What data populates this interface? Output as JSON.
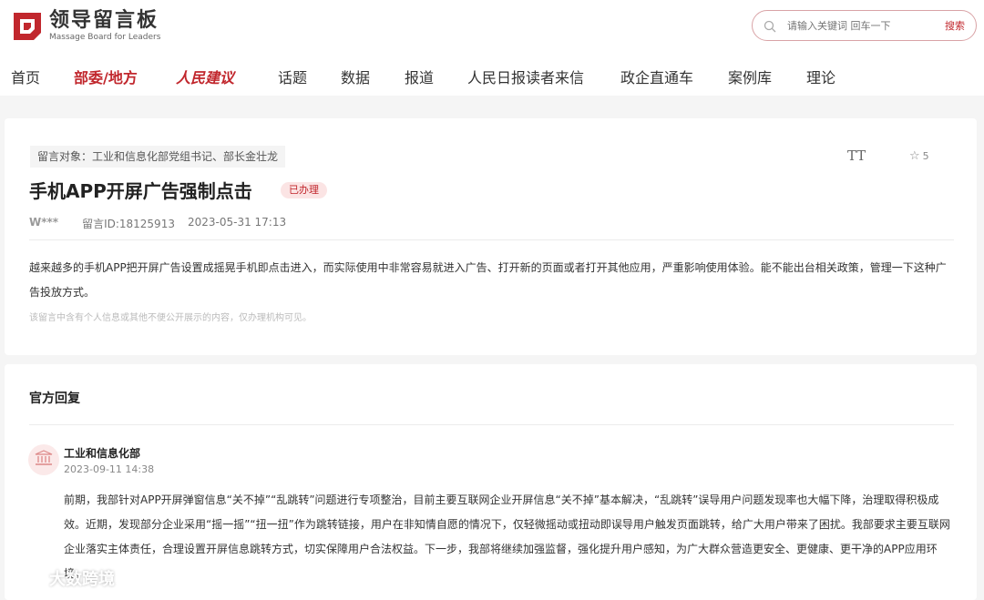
{
  "header": {
    "logo_title": "领导留言板",
    "logo_subtitle": "Massage Board for Leaders",
    "search": {
      "placeholder": "请输入关键词 回车一下",
      "button_label": "搜索"
    }
  },
  "nav": [
    {
      "label": "首页",
      "active": false
    },
    {
      "label": "部委/地方",
      "active": true
    },
    {
      "label": "人民建议",
      "active": false
    },
    {
      "label": "话题",
      "active": false
    },
    {
      "label": "数据",
      "active": false
    },
    {
      "label": "报道",
      "active": false
    },
    {
      "label": "人民日报读者来信",
      "active": false
    },
    {
      "label": "政企直通车",
      "active": false
    },
    {
      "label": "案例库",
      "active": false
    },
    {
      "label": "理论",
      "active": false
    }
  ],
  "message": {
    "target": "留言对象：工业和信息化部党组书记、部长金壮龙",
    "font_toggle": "TT",
    "star_count": "5",
    "title": "手机APP开屏广告强制点击",
    "status": "已办理",
    "author": "W***",
    "message_id": "留言ID:18125913",
    "timestamp": "2023-05-31 17:13",
    "body": "越来越多的手机APP把开屏广告设置成摇晃手机即点击进入，而实际使用中非常容易就进入广告、打开新的页面或者打开其他应用，严重影响使用体验。能不能出台相关政策，管理一下这种广告投放方式。",
    "privacy_note": "该留言中含有个人信息或其他不便公开展示的内容，仅办理机构可见。"
  },
  "reply": {
    "heading": "官方回复",
    "department": "工业和信息化部",
    "date": "2023-09-11 14:38",
    "body": "前期，我部针对APP开屏弹窗信息“关不掉”“乱跳转”问题进行专项整治，目前主要互联网企业开屏信息“关不掉”基本解决，“乱跳转”误导用户问题发现率也大幅下降，治理取得积极成效。近期，发现部分企业采用“摇一摇”“扭一扭”作为跳转链接，用户在非知情自愿的情况下，仅轻微摇动或扭动即误导用户触发页面跳转，给广大用户带来了困扰。我部要求主要互联网企业落实主体责任，合理设置开屏信息跳转方式，切实保障用户合法权益。下一步，我部将继续加强监督，强化提升用户感知，为广大群众营造更安全、更健康、更干净的APP应用环境。"
  },
  "watermark": {
    "text": "大数跨境"
  },
  "colors": {
    "accent": "#c1272d",
    "badge_bg": "#fbe4e4",
    "page_bg": "#f5f5f5"
  }
}
